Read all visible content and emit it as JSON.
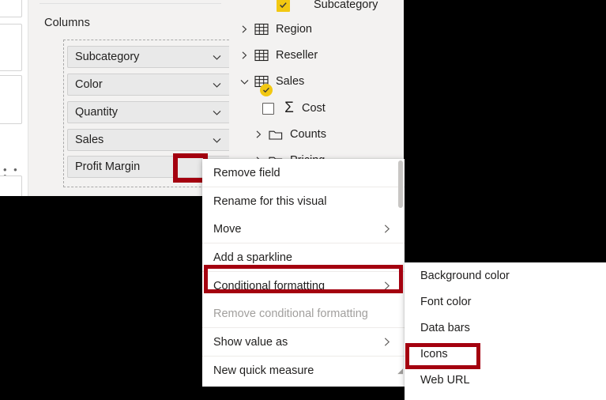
{
  "build_pane": {
    "well_title": "Columns",
    "fields": [
      {
        "label": "Subcategory",
        "chevron": "chevron-down-icon",
        "remove": "close-icon"
      },
      {
        "label": "Color",
        "chevron": "chevron-down-icon",
        "remove": "close-icon"
      },
      {
        "label": "Quantity",
        "chevron": "chevron-down-icon",
        "remove": "close-icon"
      },
      {
        "label": "Sales",
        "chevron": "chevron-down-icon",
        "remove": "close-icon"
      },
      {
        "label": "Profit Margin",
        "chevron": "chevron-down-icon",
        "remove": ""
      }
    ]
  },
  "fields_pane": {
    "tree": [
      {
        "label": "Subcategory",
        "icon": "checkbox-checked-yellow",
        "expander": "",
        "indent": 0
      },
      {
        "label": "Region",
        "icon": "table-icon",
        "expander": "chevron-right-icon",
        "indent": 0
      },
      {
        "label": "Reseller",
        "icon": "table-icon",
        "expander": "chevron-right-icon",
        "indent": 0
      },
      {
        "label": "Sales",
        "icon": "table-icon-checked",
        "expander": "chevron-down-icon",
        "indent": 0
      },
      {
        "label": "Cost",
        "icon": "checkbox-unchecked",
        "expander": "sigma-icon",
        "indent": 1
      },
      {
        "label": "Counts",
        "icon": "folder-icon",
        "expander": "chevron-right-icon",
        "indent": 1
      },
      {
        "label": "Pricing",
        "icon": "folder-icon",
        "expander": "chevron-right-icon",
        "indent": 1
      }
    ]
  },
  "context_menu": {
    "items": [
      {
        "label": "Remove field",
        "arrow": "",
        "disabled": false
      },
      {
        "label": "Rename for this visual",
        "arrow": "",
        "disabled": false
      },
      {
        "label": "Move",
        "arrow": "chevron-right-icon",
        "disabled": false
      },
      {
        "label": "Add a sparkline",
        "arrow": "",
        "disabled": false
      },
      {
        "label": "Conditional formatting",
        "arrow": "chevron-right-icon",
        "disabled": false
      },
      {
        "label": "Remove conditional formatting",
        "arrow": "",
        "disabled": true
      },
      {
        "label": "Show value as",
        "arrow": "chevron-right-icon",
        "disabled": false
      },
      {
        "label": "New quick measure",
        "arrow": "",
        "disabled": false
      }
    ],
    "clipped_item": ""
  },
  "sub_menu": {
    "items": [
      {
        "label": "Background color"
      },
      {
        "label": "Font color"
      },
      {
        "label": "Data bars"
      },
      {
        "label": "Icons"
      },
      {
        "label": "Web URL"
      }
    ]
  },
  "highlights": {
    "color": "#a4000f",
    "targets": [
      "profit-margin-chevron",
      "conditional-formatting",
      "icons"
    ]
  },
  "colors": {
    "pane_bg": "#f3f2f1",
    "pill_bg": "#e9e9e9",
    "menu_bg": "#ffffff",
    "text": "#201f1e",
    "disabled_text": "#a19f9d",
    "accent_yellow": "#f2c811",
    "redact": "#000000"
  },
  "misc": {
    "ellipsis": "• • •"
  }
}
